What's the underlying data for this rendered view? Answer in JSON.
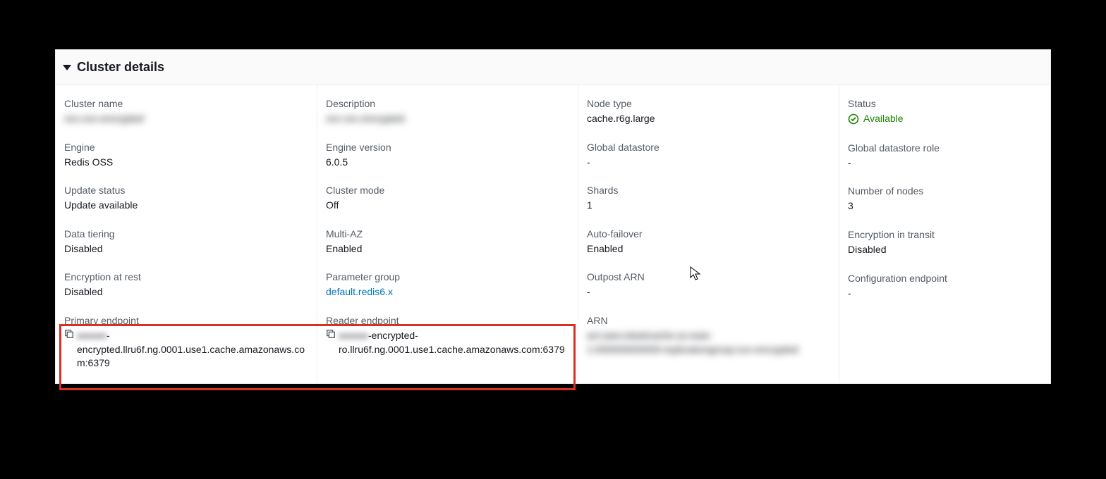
{
  "section_title": "Cluster details",
  "col1": {
    "cluster_name_label": "Cluster name",
    "cluster_name_value": "xxx-xxx-encrypted",
    "engine_label": "Engine",
    "engine_value": "Redis OSS",
    "update_status_label": "Update status",
    "update_status_value": "Update available",
    "data_tiering_label": "Data tiering",
    "data_tiering_value": "Disabled",
    "encryption_at_rest_label": "Encryption at rest",
    "encryption_at_rest_value": "Disabled",
    "primary_endpoint_label": "Primary endpoint",
    "primary_endpoint_prefix": "xxxxxx",
    "primary_endpoint_value": "-encrypted.llru6f.ng.0001.use1.cache.amazonaws.com:6379"
  },
  "col2": {
    "description_label": "Description",
    "description_value": "xxx xxx encrypted",
    "engine_version_label": "Engine version",
    "engine_version_value": "6.0.5",
    "cluster_mode_label": "Cluster mode",
    "cluster_mode_value": "Off",
    "multi_az_label": "Multi-AZ",
    "multi_az_value": "Enabled",
    "parameter_group_label": "Parameter group",
    "parameter_group_value": "default.redis6.x",
    "reader_endpoint_label": "Reader endpoint",
    "reader_endpoint_prefix": "xxxxxx",
    "reader_endpoint_value": "-encrypted-ro.llru6f.ng.0001.use1.cache.amazonaws.com:6379"
  },
  "col3": {
    "node_type_label": "Node type",
    "node_type_value": "cache.r6g.large",
    "global_datastore_label": "Global datastore",
    "global_datastore_value": "-",
    "shards_label": "Shards",
    "shards_value": "1",
    "auto_failover_label": "Auto-failover",
    "auto_failover_value": "Enabled",
    "outpost_arn_label": "Outpost ARN",
    "outpost_arn_value": "-",
    "arn_label": "ARN",
    "arn_value": "arn:aws:elasticache:us-east-1:000000000000:replicationgroup:xxx-encrypted"
  },
  "col4": {
    "status_label": "Status",
    "status_value": "Available",
    "global_datastore_role_label": "Global datastore role",
    "global_datastore_role_value": "-",
    "number_of_nodes_label": "Number of nodes",
    "number_of_nodes_value": "3",
    "encryption_in_transit_label": "Encryption in transit",
    "encryption_in_transit_value": "Disabled",
    "configuration_endpoint_label": "Configuration endpoint",
    "configuration_endpoint_value": "-"
  }
}
